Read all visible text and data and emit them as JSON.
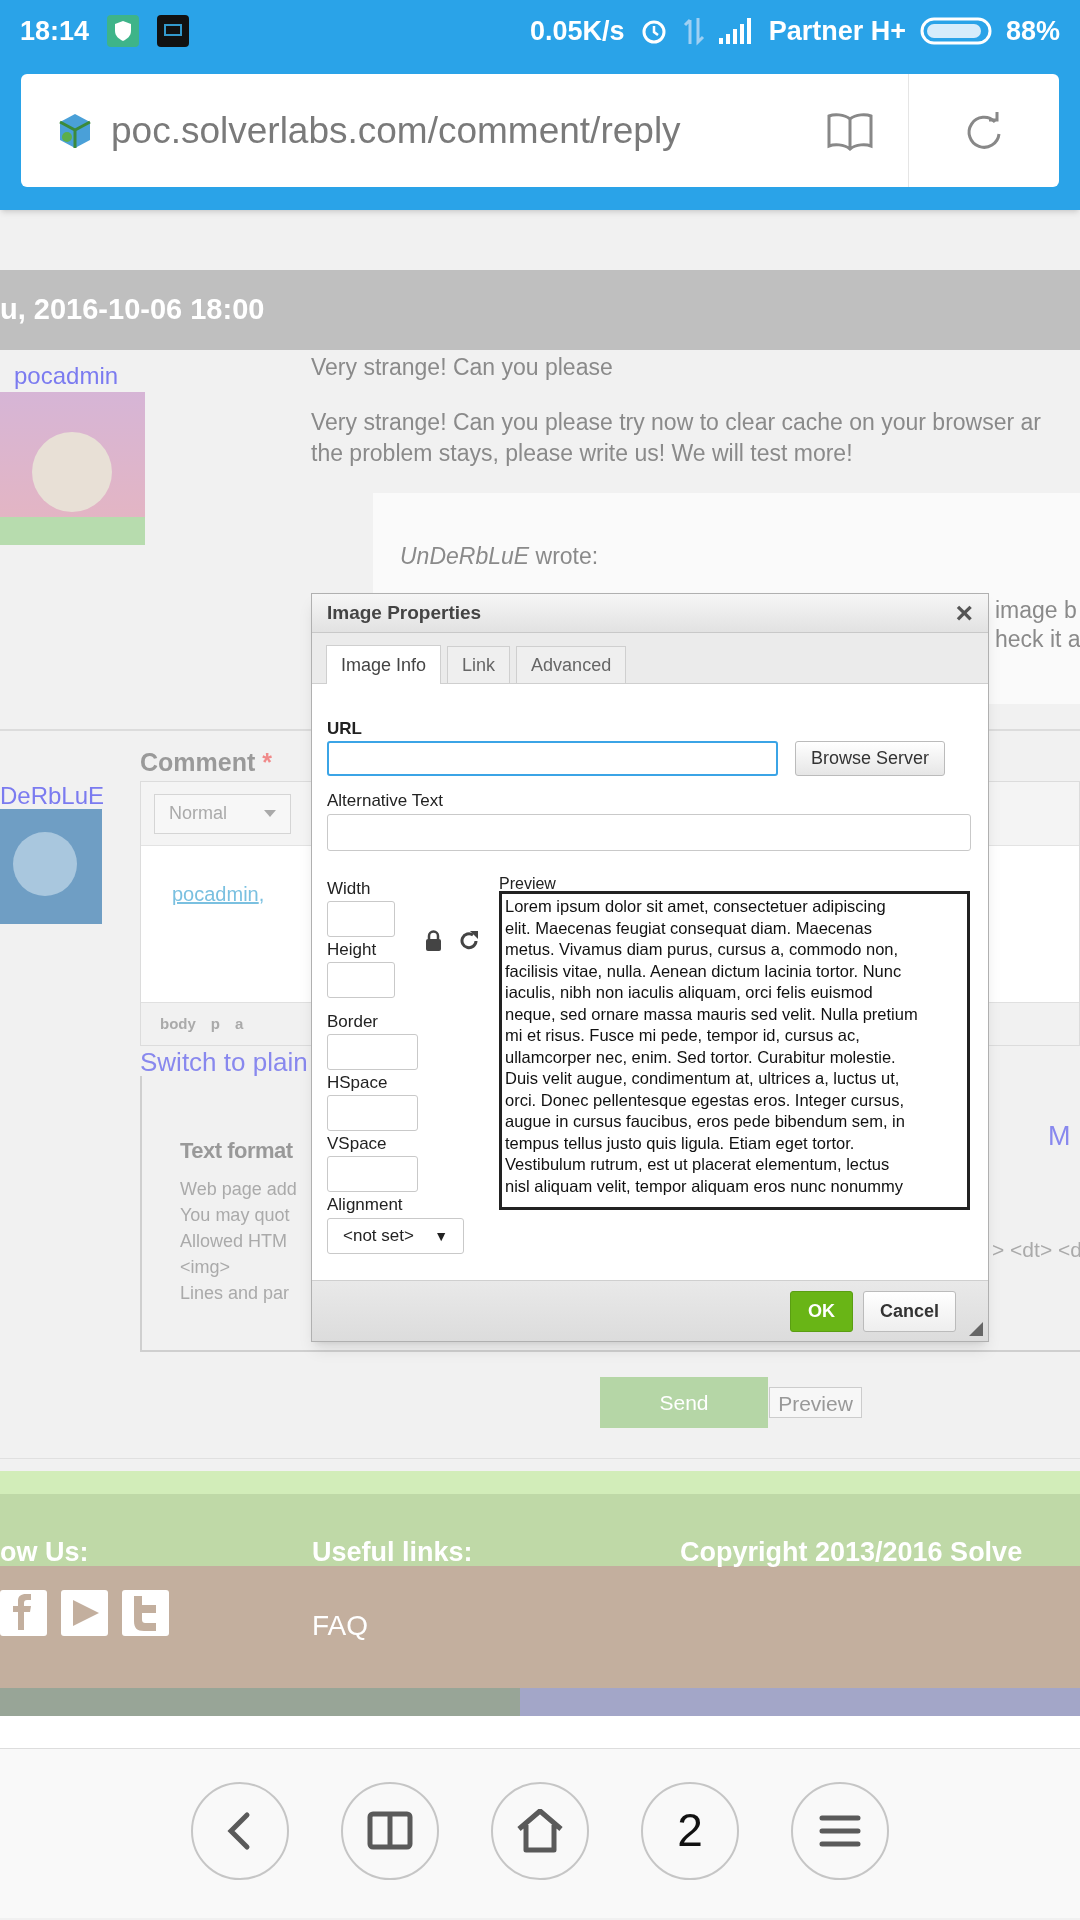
{
  "status_bar": {
    "time": "18:14",
    "speed": "0.05K/s",
    "carrier": "Partner H+",
    "battery": "88%"
  },
  "address_bar": {
    "url": "poc.solverlabs.com/comment/reply"
  },
  "comment": {
    "date": "u, 2016-10-06 18:00",
    "author": "pocadmin",
    "title": "Very strange! Can you please",
    "body_lines": [
      "Very strange! Can you please try now to clear cache on your browser ar",
      "the problem stays, please write us! We will test more!"
    ],
    "quote": {
      "intro": "*UnDeRbLuE* wrote:",
      "lines": [
        "image b",
        "heck it a"
      ]
    }
  },
  "reply_form": {
    "author": "DeRbLuE",
    "label": "Comment",
    "required_mark": "*",
    "format_dropdown": "Normal",
    "mention": "pocadmin",
    "mention_suffix": ",",
    "path": [
      "body",
      "p",
      "a"
    ],
    "switch_link": "Switch to plain",
    "more_link": "M",
    "text_format": {
      "title": "Text format",
      "lines": [
        "Web page add",
        "You may quot",
        "Allowed HTM",
        "<img>",
        "Lines and par"
      ],
      "right_fragment": "> <dt> <d"
    },
    "buttons": [
      {
        "label": "Send",
        "kind": "primary"
      },
      {
        "label": "Preview",
        "kind": "secondary"
      }
    ]
  },
  "dialog": {
    "title": "Image Properties",
    "close": "×",
    "tabs": [
      {
        "label": "Image Info",
        "selected": true
      },
      {
        "label": "Link",
        "selected": false
      },
      {
        "label": "Advanced",
        "selected": false
      }
    ],
    "url_label": "URL",
    "browse_button": "Browse Server",
    "alt_label": "Alternative Text",
    "size_fields": [
      "Width",
      "Height"
    ],
    "spacing_fields": [
      "Border",
      "HSpace",
      "VSpace"
    ],
    "alignment": {
      "label": "Alignment",
      "value": "<not set>",
      "arrow": "▼"
    },
    "preview": {
      "label": "Preview",
      "lines": [
        "Lorem ipsum dolor sit amet, consectetuer adipiscing",
        "elit. Maecenas feugiat consequat diam. Maecenas",
        "metus. Vivamus diam purus, cursus a, commodo non,",
        "facilisis vitae, nulla. Aenean dictum lacinia tortor. Nunc",
        "iaculis, nibh non iaculis aliquam, orci felis euismod",
        "neque, sed ornare massa mauris sed velit. Nulla pretium",
        "mi et risus. Fusce mi pede, tempor id, cursus ac,",
        "ullamcorper nec, enim. Sed tortor. Curabitur molestie.",
        "Duis velit augue, condimentum at, ultrices a, luctus ut,",
        "orci. Donec pellentesque egestas eros. Integer cursus,",
        "augue in cursus faucibus, eros pede bibendum sem, in",
        "tempus tellus justo quis ligula. Etiam eget tortor.",
        "Vestibulum rutrum, est ut placerat elementum, lectus",
        "nisl aliquam velit, tempor aliquam eros nunc nonummy"
      ]
    },
    "buttons": [
      {
        "label": "OK",
        "kind": "primary"
      },
      {
        "label": "Cancel",
        "kind": "secondary"
      }
    ]
  },
  "footer": {
    "columns": [
      {
        "heading": "ow Us:"
      },
      {
        "heading": "Useful links:",
        "links": [
          "FAQ"
        ]
      },
      {
        "heading": "Copyright 2013/2016 Solve"
      }
    ]
  },
  "nav_bar": {
    "tab_count": "2"
  }
}
